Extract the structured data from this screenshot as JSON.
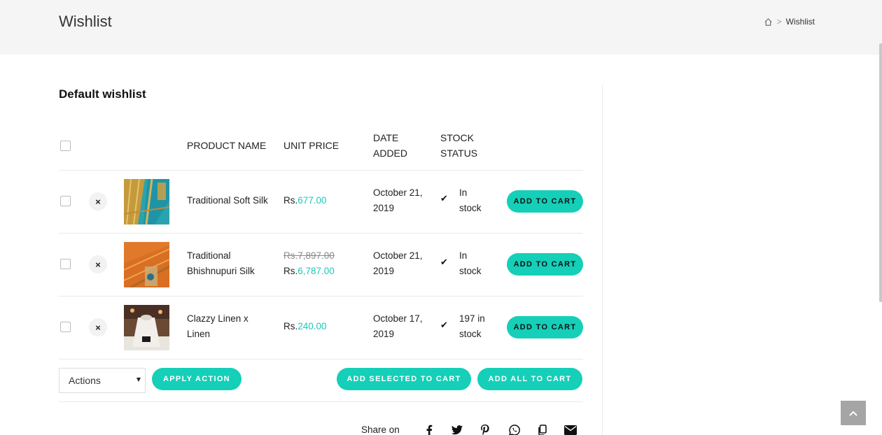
{
  "header": {
    "title": "Wishlist",
    "breadcrumb": {
      "home_icon": "home-icon",
      "separator": ">",
      "current": "Wishlist"
    }
  },
  "wishlist": {
    "title": "Default wishlist",
    "columns": {
      "product_name": "PRODUCT NAME",
      "unit_price": "UNIT PRICE",
      "date_added_1": "DATE",
      "date_added_2": "ADDED",
      "stock_status_1": "STOCK",
      "stock_status_2": "STATUS"
    },
    "items": [
      {
        "name_1": "Traditional Soft Silk",
        "name_2": "",
        "price_old": "",
        "currency": "Rs.",
        "price": "677.00",
        "date_1": "October 21,",
        "date_2": "2019",
        "stock_1": "In",
        "stock_2": "stock",
        "button": "ADD TO CART",
        "remove": "×"
      },
      {
        "name_1": "Traditional",
        "name_2": "Bhishnupuri Silk",
        "price_old": "Rs.7,897.00",
        "currency": "Rs.",
        "price": "6,787.00",
        "date_1": "October 21,",
        "date_2": "2019",
        "stock_1": "In",
        "stock_2": "stock",
        "button": "ADD TO CART",
        "remove": "×"
      },
      {
        "name_1": "Clazzy Linen x",
        "name_2": "Linen",
        "price_old": "",
        "currency": "Rs.",
        "price": "240.00",
        "date_1": "October 17,",
        "date_2": "2019",
        "stock_1": "197 in",
        "stock_2": "stock",
        "button": "ADD TO CART",
        "remove": "×"
      }
    ]
  },
  "footer_actions": {
    "select_value": "Actions",
    "apply": "APPLY ACTION",
    "add_selected": "ADD SELECTED TO CART",
    "add_all": "ADD ALL TO CART"
  },
  "share": {
    "label": "Share on",
    "icons": [
      "facebook-icon",
      "twitter-icon",
      "pinterest-icon",
      "whatsapp-icon",
      "copy-icon",
      "email-icon"
    ]
  },
  "colors": {
    "accent": "#15cfb8",
    "price": "#1fc8b4",
    "header_bg": "#f5f5f5"
  }
}
